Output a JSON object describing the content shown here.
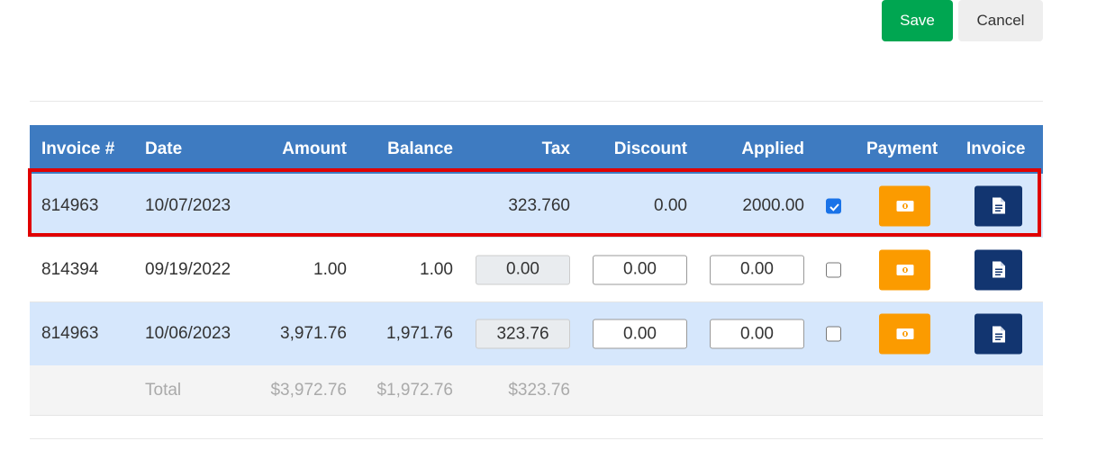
{
  "toolbar": {
    "save_label": "Save",
    "cancel_label": "Cancel"
  },
  "table": {
    "headers": {
      "invoice_num": "Invoice #",
      "date": "Date",
      "amount": "Amount",
      "balance": "Balance",
      "tax": "Tax",
      "discount": "Discount",
      "applied": "Applied",
      "payment": "Payment",
      "invoice": "Invoice"
    },
    "rows": [
      {
        "invoice_num": "814963",
        "date": "10/07/2023",
        "amount": "",
        "balance": "",
        "tax": "323.760",
        "discount": "0.00",
        "applied": "2000.00",
        "checked": true,
        "highlighted": true
      },
      {
        "invoice_num": "814394",
        "date": "09/19/2022",
        "amount": "1.00",
        "balance": "1.00",
        "tax": "0.00",
        "discount": "0.00",
        "applied": "0.00",
        "checked": false
      },
      {
        "invoice_num": "814963",
        "date": "10/06/2023",
        "amount": "3,971.76",
        "balance": "1,971.76",
        "tax": "323.76",
        "discount": "0.00",
        "applied": "0.00",
        "checked": false
      }
    ],
    "totals": {
      "label": "Total",
      "amount": "$3,972.76",
      "balance": "$1,972.76",
      "tax": "$323.76"
    }
  },
  "icons": {
    "payment": "money-bill-icon",
    "invoice": "file-document-icon"
  },
  "colors": {
    "save": "#00a651",
    "header": "#3e7bc1",
    "row_highlight": "#d6e7fc",
    "payment_button": "#fb9b00",
    "invoice_button": "#123570",
    "selection_outline": "#e00000"
  }
}
